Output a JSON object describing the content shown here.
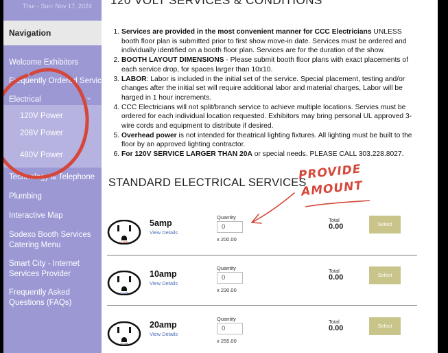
{
  "sidebar": {
    "date_strip": "Thur - Sun: Nov 17, 2024",
    "nav_header": "Navigation",
    "items": [
      {
        "label": "Welcome Exhibitors"
      },
      {
        "label": "Frequently Ordered Services"
      },
      {
        "label": "Electrical",
        "expanded": true
      },
      {
        "label": "120V Power"
      },
      {
        "label": "208V Power"
      },
      {
        "label": "480V Power"
      },
      {
        "label": "Technology & Telephone"
      },
      {
        "label": "Plumbing"
      },
      {
        "label": "Interactive Map"
      },
      {
        "label": "Sodexo Booth Services Catering Menu"
      },
      {
        "label": "Smart City - Internet Services Provider"
      },
      {
        "label": "Frequently Asked Questions (FAQs)"
      }
    ]
  },
  "main": {
    "page_title": "120 VOLT SERVICES & CONDITIONS",
    "rules": [
      {
        "bold": "Services are provided in the most convenient manner for CCC Electricians",
        "text": " UNLESS booth floor plan is submitted prior to first show move-in date. Services must be ordered and individually identified on a booth floor plan. Services are for the duration of the show."
      },
      {
        "bold": "BOOTH LAYOUT DIMENSIONS",
        "text": " - Please submit booth floor plans with exact placements of each service drop, for spaces larger than 10x10."
      },
      {
        "bold": "LABOR",
        "text": ": Labor is included in the initial set of the service. Special placement, testing and/or changes after the initial set will require additional labor and material charges, Labor will be harged in 1 hour increments."
      },
      {
        "bold": "",
        "text": "CCC Electricians will not split/branch service to achieve multiple locations. Servies must be ordered for each individual location requested. Exhibitors may bring personal UL approved 3-wire cords and equipment to distribute if desired."
      },
      {
        "bold": "Overhead power",
        "text": " is not intended for theatrical lighting fixtures. All lighting must be built to the floor by an approved lighting contractor."
      },
      {
        "bold": "For 120V SERVICE LARGER THAN 20A",
        "text": " or special needs. PLEASE CALL 303.228.8027."
      }
    ],
    "section_title": "STANDARD ELECTRICAL SERVICES",
    "services": [
      {
        "name": "5amp",
        "link": "View Details",
        "qty_label": "Quantity",
        "qty": "0",
        "price": "x 200.00",
        "total_label": "Total",
        "total": "0.00",
        "button": "Select",
        "outlet_tag": "5 AMP"
      },
      {
        "name": "10amp",
        "link": "View Details",
        "qty_label": "Quantity",
        "qty": "0",
        "price": "x 230.00",
        "total_label": "Total",
        "total": "0.00",
        "button": "Select",
        "outlet_tag": "10 AMP"
      },
      {
        "name": "20amp",
        "link": "View Details",
        "qty_label": "Quantity",
        "qty": "0",
        "price": "x 255.00",
        "total_label": "Total",
        "total": "0.00",
        "button": "Select",
        "outlet_tag": "20 AMP"
      }
    ]
  },
  "annotation": {
    "line1": "PROVIDE",
    "line2": "AMOUNT",
    "color": "#d5473a"
  },
  "colors": {
    "sidebar": "#9b98d4",
    "sidebar_sub": "#b6b3e0",
    "select_button": "#c9c58a",
    "link": "#4a6fb5"
  }
}
